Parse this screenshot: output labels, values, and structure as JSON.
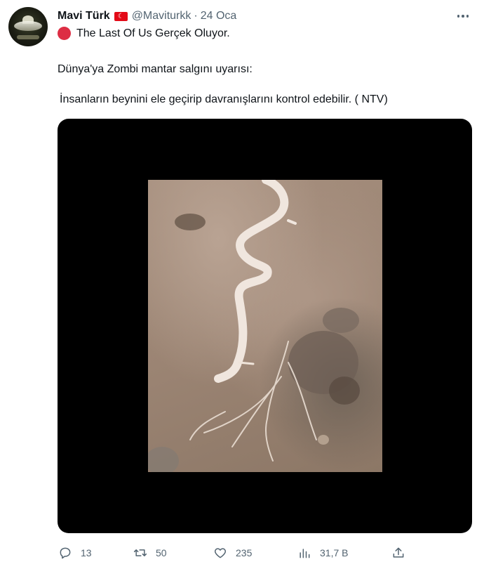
{
  "tweet": {
    "author_name": "Mavi Türk",
    "author_flag": "tr-flag",
    "handle": "@Maviturkk",
    "separator": "·",
    "date": "24 Oca",
    "line1": "The Last Of Us Gerçek Oluyor.",
    "line2": "Dünya'ya Zombi mantar salgını uyarısı:",
    "line3": "İnsanların beynini ele geçirip davranışlarını kontrol edebilir. ( NTV)"
  },
  "media": {
    "type": "video-thumbnail",
    "background": "#000000"
  },
  "actions": {
    "reply_count": "13",
    "retweet_count": "50",
    "like_count": "235",
    "views_count": "31,7 B"
  },
  "colors": {
    "text": "#0f1419",
    "secondary": "#536471",
    "red_circle": "#dd2e44",
    "flag_red": "#e30a17"
  }
}
